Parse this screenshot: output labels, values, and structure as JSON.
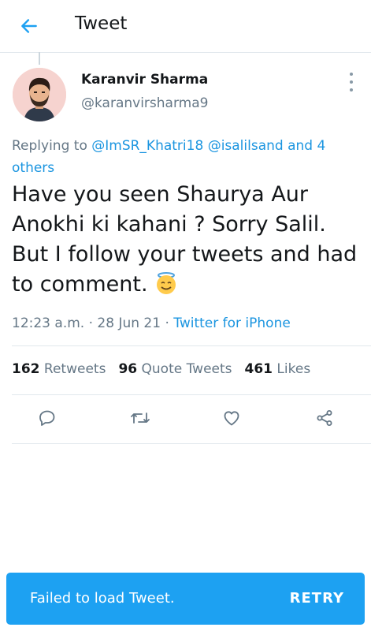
{
  "header": {
    "title": "Tweet"
  },
  "author": {
    "name": "Karanvir Sharma",
    "handle": "@karanvirsharma9"
  },
  "reply": {
    "prefix": "Replying to",
    "mention1": "@ImSR_Khatri18",
    "mention2": "@isalilsand",
    "joiner": "and",
    "others": "4 others"
  },
  "tweet": {
    "text": "Have you seen Shaurya Aur Anokhi ki kahani ? Sorry Salil. But I follow your tweets and had to comment.",
    "emoji": "smiling-face-with-halo",
    "time": "12:23 a.m.",
    "date": "28 Jun 21",
    "source": "Twitter for iPhone"
  },
  "stats": {
    "retweets_count": "162",
    "retweets_label": "Retweets",
    "quotes_count": "96",
    "quotes_label": "Quote Tweets",
    "likes_count": "461",
    "likes_label": "Likes"
  },
  "icons": [
    "back-arrow-icon",
    "more-icon",
    "reply-icon",
    "retweet-icon",
    "like-icon",
    "share-icon"
  ],
  "colors": {
    "accent": "#1da1f2",
    "link": "#1b95e0",
    "secondary_text": "#657786",
    "icon": "#657786"
  },
  "snackbar": {
    "message": "Failed to load Tweet.",
    "action": "RETRY"
  }
}
